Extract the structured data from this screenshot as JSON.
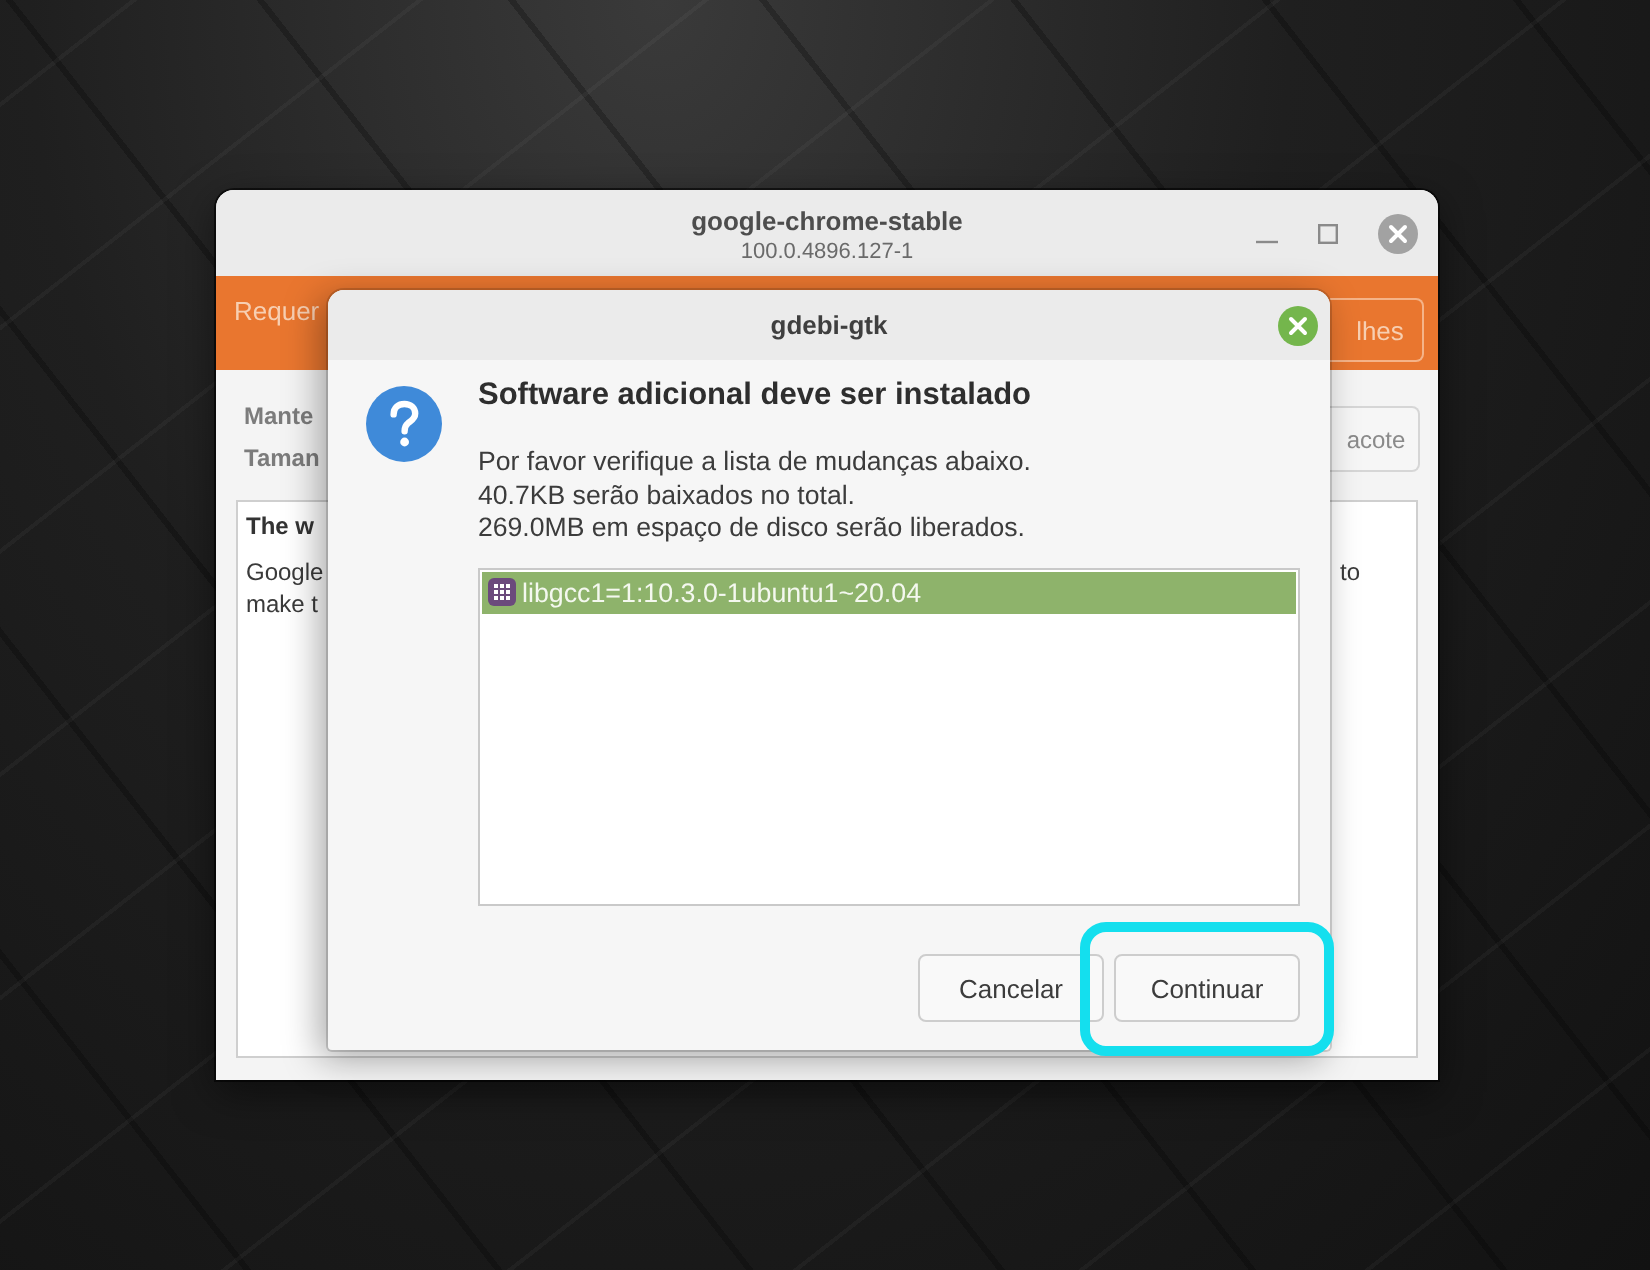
{
  "main_window": {
    "title": "google-chrome-stable",
    "subtitle": "100.0.4896.127-1",
    "banner": {
      "text": "Requer",
      "button": "lhes"
    },
    "info_labels": [
      "Mante",
      "Taman"
    ],
    "action_button": "acote",
    "description": {
      "heading": "The w",
      "lines": [
        {
          "start": "Google",
          "end": "to"
        },
        {
          "start": "make t"
        }
      ]
    }
  },
  "dialog": {
    "title": "gdebi-gtk",
    "heading": "Software adicional deve ser instalado",
    "message_lines": [
      "Por favor verifique a lista de mudanças abaixo.",
      "40.7KB serão baixados no total.",
      "269.0MB em espaço de disco serão liberados."
    ],
    "changes": [
      {
        "label": "libgcc1=1:10.3.0-1ubuntu1~20.04",
        "selected": true
      }
    ],
    "buttons": [
      {
        "label": "Cancelar",
        "highlighted": false
      },
      {
        "label": "Continuar",
        "highlighted": true
      }
    ]
  }
}
